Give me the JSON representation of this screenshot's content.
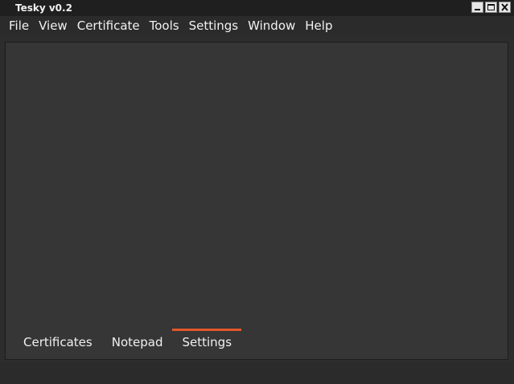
{
  "window": {
    "title": "Tesky v0.2"
  },
  "menubar": {
    "items": [
      {
        "label": "File"
      },
      {
        "label": "View"
      },
      {
        "label": "Certificate"
      },
      {
        "label": "Tools"
      },
      {
        "label": "Settings"
      },
      {
        "label": "Window"
      },
      {
        "label": "Help"
      }
    ]
  },
  "tabs": {
    "items": [
      {
        "label": "Certificates",
        "active": false
      },
      {
        "label": "Notepad",
        "active": false
      },
      {
        "label": "Settings",
        "active": true
      }
    ]
  },
  "colors": {
    "accent": "#e0582a",
    "panel": "#363636",
    "background": "#2b2b2b",
    "text": "#f0f0f0"
  },
  "icons": {
    "minimize": "minimize-icon",
    "maximize": "maximize-icon",
    "close": "close-icon"
  }
}
